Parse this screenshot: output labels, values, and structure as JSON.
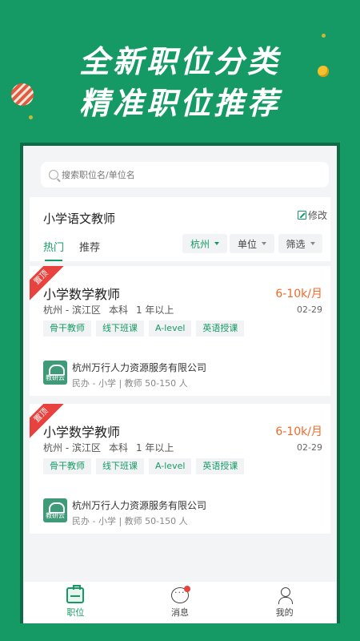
{
  "promo": {
    "line1": "全新职位分类",
    "line2": "精准职位推荐"
  },
  "search": {
    "placeholder": "搜索职位名/单位名"
  },
  "filter": {
    "position_title": "小学语文教师",
    "edit_label": "修改",
    "tabs": [
      "热门",
      "推荐"
    ],
    "city": "杭州",
    "unit": "单位",
    "filter": "筛选"
  },
  "jobs": [
    {
      "badge": "置顶",
      "title": "小学数学教师",
      "salary": "6-10k/月",
      "location": "杭州 - 滨江区",
      "education": "本科",
      "experience": "1 年以上",
      "date": "02-29",
      "tags": [
        "骨干教师",
        "线下班课",
        "A-level",
        "英语授课"
      ],
      "company_name": "杭州万行人力资源服务有限公司",
      "company_type": "民办 - 小学",
      "company_size": "教师 50-150 人",
      "logo_text": "教研云"
    },
    {
      "badge": "置顶",
      "title": "小学数学教师",
      "salary": "6-10k/月",
      "location": "杭州 - 滨江区",
      "education": "本科",
      "experience": "1 年以上",
      "date": "02-29",
      "tags": [
        "骨干教师",
        "线下班课",
        "A-level",
        "英语授课"
      ],
      "company_name": "杭州万行人力资源服务有限公司",
      "company_type": "民办 - 小学",
      "company_size": "教师 50-150 人",
      "logo_text": "教研云"
    }
  ],
  "tabbar": [
    {
      "label": "职位",
      "icon": "briefcase-icon",
      "active": true
    },
    {
      "label": "消息",
      "icon": "chat-icon",
      "active": false
    },
    {
      "label": "我的",
      "icon": "user-icon",
      "active": false
    }
  ],
  "colors": {
    "brand": "#169a65",
    "salary": "#f06a28",
    "badge": "#e8423e"
  }
}
